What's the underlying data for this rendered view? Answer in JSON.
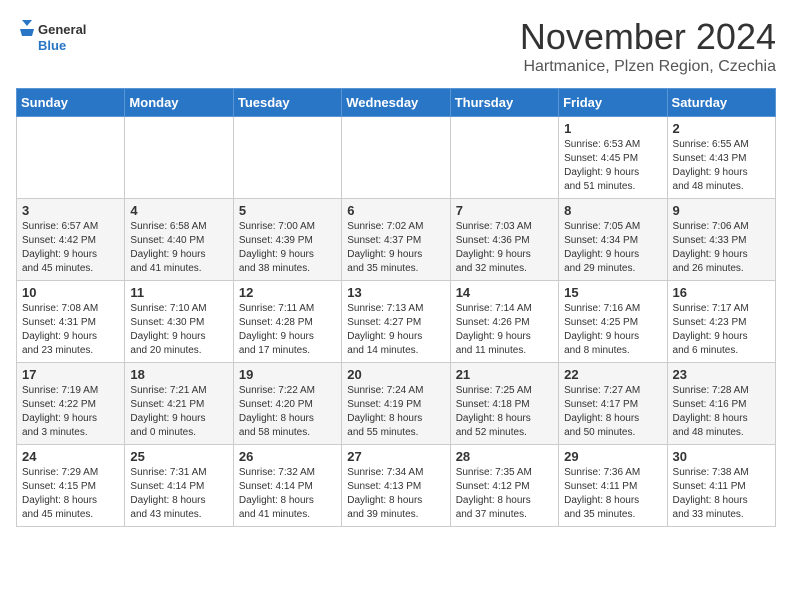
{
  "header": {
    "logo_line1": "General",
    "logo_line2": "Blue",
    "month_title": "November 2024",
    "subtitle": "Hartmanice, Plzen Region, Czechia"
  },
  "weekdays": [
    "Sunday",
    "Monday",
    "Tuesday",
    "Wednesday",
    "Thursday",
    "Friday",
    "Saturday"
  ],
  "weeks": [
    [
      {
        "day": "",
        "info": ""
      },
      {
        "day": "",
        "info": ""
      },
      {
        "day": "",
        "info": ""
      },
      {
        "day": "",
        "info": ""
      },
      {
        "day": "",
        "info": ""
      },
      {
        "day": "1",
        "info": "Sunrise: 6:53 AM\nSunset: 4:45 PM\nDaylight: 9 hours\nand 51 minutes."
      },
      {
        "day": "2",
        "info": "Sunrise: 6:55 AM\nSunset: 4:43 PM\nDaylight: 9 hours\nand 48 minutes."
      }
    ],
    [
      {
        "day": "3",
        "info": "Sunrise: 6:57 AM\nSunset: 4:42 PM\nDaylight: 9 hours\nand 45 minutes."
      },
      {
        "day": "4",
        "info": "Sunrise: 6:58 AM\nSunset: 4:40 PM\nDaylight: 9 hours\nand 41 minutes."
      },
      {
        "day": "5",
        "info": "Sunrise: 7:00 AM\nSunset: 4:39 PM\nDaylight: 9 hours\nand 38 minutes."
      },
      {
        "day": "6",
        "info": "Sunrise: 7:02 AM\nSunset: 4:37 PM\nDaylight: 9 hours\nand 35 minutes."
      },
      {
        "day": "7",
        "info": "Sunrise: 7:03 AM\nSunset: 4:36 PM\nDaylight: 9 hours\nand 32 minutes."
      },
      {
        "day": "8",
        "info": "Sunrise: 7:05 AM\nSunset: 4:34 PM\nDaylight: 9 hours\nand 29 minutes."
      },
      {
        "day": "9",
        "info": "Sunrise: 7:06 AM\nSunset: 4:33 PM\nDaylight: 9 hours\nand 26 minutes."
      }
    ],
    [
      {
        "day": "10",
        "info": "Sunrise: 7:08 AM\nSunset: 4:31 PM\nDaylight: 9 hours\nand 23 minutes."
      },
      {
        "day": "11",
        "info": "Sunrise: 7:10 AM\nSunset: 4:30 PM\nDaylight: 9 hours\nand 20 minutes."
      },
      {
        "day": "12",
        "info": "Sunrise: 7:11 AM\nSunset: 4:28 PM\nDaylight: 9 hours\nand 17 minutes."
      },
      {
        "day": "13",
        "info": "Sunrise: 7:13 AM\nSunset: 4:27 PM\nDaylight: 9 hours\nand 14 minutes."
      },
      {
        "day": "14",
        "info": "Sunrise: 7:14 AM\nSunset: 4:26 PM\nDaylight: 9 hours\nand 11 minutes."
      },
      {
        "day": "15",
        "info": "Sunrise: 7:16 AM\nSunset: 4:25 PM\nDaylight: 9 hours\nand 8 minutes."
      },
      {
        "day": "16",
        "info": "Sunrise: 7:17 AM\nSunset: 4:23 PM\nDaylight: 9 hours\nand 6 minutes."
      }
    ],
    [
      {
        "day": "17",
        "info": "Sunrise: 7:19 AM\nSunset: 4:22 PM\nDaylight: 9 hours\nand 3 minutes."
      },
      {
        "day": "18",
        "info": "Sunrise: 7:21 AM\nSunset: 4:21 PM\nDaylight: 9 hours\nand 0 minutes."
      },
      {
        "day": "19",
        "info": "Sunrise: 7:22 AM\nSunset: 4:20 PM\nDaylight: 8 hours\nand 58 minutes."
      },
      {
        "day": "20",
        "info": "Sunrise: 7:24 AM\nSunset: 4:19 PM\nDaylight: 8 hours\nand 55 minutes."
      },
      {
        "day": "21",
        "info": "Sunrise: 7:25 AM\nSunset: 4:18 PM\nDaylight: 8 hours\nand 52 minutes."
      },
      {
        "day": "22",
        "info": "Sunrise: 7:27 AM\nSunset: 4:17 PM\nDaylight: 8 hours\nand 50 minutes."
      },
      {
        "day": "23",
        "info": "Sunrise: 7:28 AM\nSunset: 4:16 PM\nDaylight: 8 hours\nand 48 minutes."
      }
    ],
    [
      {
        "day": "24",
        "info": "Sunrise: 7:29 AM\nSunset: 4:15 PM\nDaylight: 8 hours\nand 45 minutes."
      },
      {
        "day": "25",
        "info": "Sunrise: 7:31 AM\nSunset: 4:14 PM\nDaylight: 8 hours\nand 43 minutes."
      },
      {
        "day": "26",
        "info": "Sunrise: 7:32 AM\nSunset: 4:14 PM\nDaylight: 8 hours\nand 41 minutes."
      },
      {
        "day": "27",
        "info": "Sunrise: 7:34 AM\nSunset: 4:13 PM\nDaylight: 8 hours\nand 39 minutes."
      },
      {
        "day": "28",
        "info": "Sunrise: 7:35 AM\nSunset: 4:12 PM\nDaylight: 8 hours\nand 37 minutes."
      },
      {
        "day": "29",
        "info": "Sunrise: 7:36 AM\nSunset: 4:11 PM\nDaylight: 8 hours\nand 35 minutes."
      },
      {
        "day": "30",
        "info": "Sunrise: 7:38 AM\nSunset: 4:11 PM\nDaylight: 8 hours\nand 33 minutes."
      }
    ]
  ]
}
